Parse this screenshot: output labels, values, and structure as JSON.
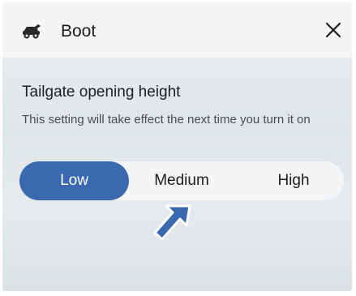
{
  "header": {
    "title": "Boot",
    "icon": "car-boot-icon",
    "close_icon": "close-icon"
  },
  "setting": {
    "title": "Tailgate opening height",
    "description": "This setting will take effect the next time you turn it on"
  },
  "height_options": [
    {
      "label": "Low",
      "selected": true
    },
    {
      "label": "Medium",
      "selected": false
    },
    {
      "label": "High",
      "selected": false
    }
  ],
  "annotation": {
    "icon": "pointer-arrow-icon",
    "target": "Medium"
  },
  "colors": {
    "accent": "#3b69b0",
    "header_bg": "#f3f5f6",
    "panel_bg": "#e3e9ec",
    "text": "#1d1d1d"
  }
}
